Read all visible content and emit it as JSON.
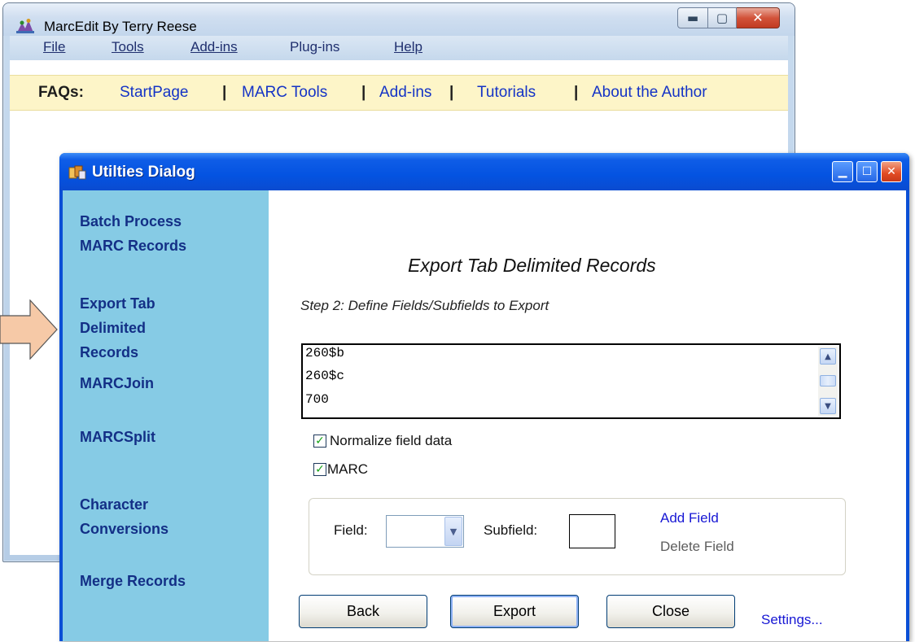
{
  "main_window": {
    "title": "MarcEdit By Terry Reese",
    "menu": [
      {
        "label": "File"
      },
      {
        "label": "Tools"
      },
      {
        "label": "Add-ins"
      },
      {
        "label": "Plug-ins"
      },
      {
        "label": "Help"
      }
    ],
    "faq": {
      "label": "FAQs:",
      "links": [
        "StartPage",
        "MARC Tools",
        "Add-ins",
        "Tutorials",
        "About the Author"
      ],
      "separator": "|"
    }
  },
  "dialog": {
    "title": "Utilties Dialog",
    "sidebar": [
      "Batch Process MARC Records",
      "Export Tab Delimited Records",
      "MARCJoin",
      "MARCSplit",
      "Character Conversions",
      "Merge Records"
    ],
    "heading": "Export Tab Delimited Records",
    "step": "Step 2:  Define Fields/Subfields to Export",
    "field_list": [
      "260$b",
      "260$c",
      "700"
    ],
    "checkboxes": [
      {
        "label": "Normalize field data",
        "checked": true
      },
      {
        "label": "MARC",
        "checked": true
      }
    ],
    "field_group": {
      "field_label": "Field:",
      "field_value": "",
      "subfield_label": "Subfield:",
      "subfield_value": "",
      "add_field": "Add Field",
      "delete_field": "Delete Field"
    },
    "buttons": {
      "back": "Back",
      "export": "Export",
      "close": "Close"
    },
    "settings_link": "Settings..."
  },
  "colors": {
    "sidebar_bg": "#86cbe5",
    "sidebar_text": "#132f86",
    "link_blue": "#1717d4",
    "faq_bar": "#fdf5c8",
    "xp_titlebar": "#0453e1",
    "arrow_fill": "#f6c9a7"
  },
  "icons": {
    "main_app": "marcedit-app-icon",
    "dialog_app": "utilities-app-icon",
    "pointer": "right-arrow"
  }
}
